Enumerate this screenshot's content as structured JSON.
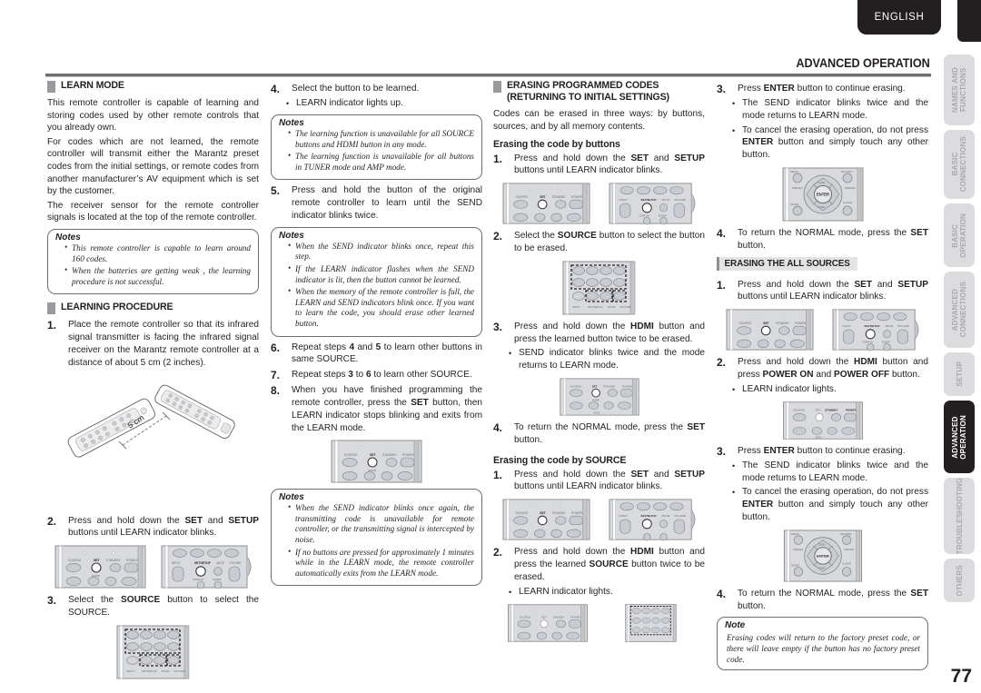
{
  "header": {
    "language_badge": "ENGLISH",
    "chapter_title": "ADVANCED OPERATION",
    "page_number": "77"
  },
  "sidebar": {
    "tabs": [
      {
        "label": "NAMES AND\nFUNCTIONS",
        "active": false
      },
      {
        "label": "BASIC\nCONNECTIONS",
        "active": false
      },
      {
        "label": "BASIC\nOPERATION",
        "active": false
      },
      {
        "label": "ADVANCED\nCONNECTIONS",
        "active": false
      },
      {
        "label": "SETUP",
        "active": false
      },
      {
        "label": "ADVANCED\nOPERATION",
        "active": true
      },
      {
        "label": "TROUBLESHOOTING",
        "active": false
      },
      {
        "label": "OTHERS",
        "active": false
      }
    ]
  },
  "col1": {
    "learn_mode_heading": "LEARN MODE",
    "p1": "This remote controller is capable of learning and storing codes used by other remote controls that you already own.",
    "p2": "For codes which are not learned, the remote controller will transmit either the Marantz preset codes from the initial settings, or remote codes from another manufacturer’s AV equipment which is set by the customer.",
    "p3": "The receiver sensor for the remote controller signals is located at the top of the remote controller.",
    "notes_label": "Notes",
    "note1": "This remote controller is capable to learn around 160 codes.",
    "note2": "When the batteries are getting weak , the learning procedure is not successful.",
    "procedure_heading": "LEARNING PROCEDURE",
    "step1_num": "1.",
    "step1_text": "Place the remote controller so that its infrared signal transmitter is facing the infrared signal receiver on the Marantz remote controller at a distance of about 5 cm (2 inches).",
    "fig_distance_label": "5 cm",
    "step2_num": "2.",
    "step2_a": "Press and hold down the ",
    "step2_set": "SET",
    "step2_b": " and ",
    "step2_setup": "SETUP",
    "step2_c": " buttons until LEARN indicator blinks.",
    "step3_num": "3.",
    "step3_a": "Select the ",
    "step3_source": "SOURCE",
    "step3_b": " button to select the SOURCE."
  },
  "col2": {
    "step4_num": "4.",
    "step4_text": "Select the button to be learned.",
    "step4_bullet": "LEARN indicator lights up.",
    "notes1_label": "Notes",
    "notes1_item1": "The learning function is unavailable for all SOURCE buttons and HDMI button in any mode.",
    "notes1_item2": "The learning function is unavailable for all buttons in TUNER mode and AMP mode.",
    "step5_num": "5.",
    "step5_text": "Press and hold the button of the original remote controller to learn until the SEND indicator blinks twice.",
    "notes2_label": "Notes",
    "notes2_item1": "When the SEND indicator blinks once, repeat this step.",
    "notes2_item2": "If the LEARN indicator flashes when the SEND indicator is lit, then the button cannot be learned.",
    "notes2_item3": "When the memory of the remote controller is full, the LEARN and SEND indicators blink once. If you want to learn the code, you should erase other learned button.",
    "step6_num": "6.",
    "step6_a": "Repeat steps ",
    "step6_4": "4",
    "step6_b": " and ",
    "step6_5": "5",
    "step6_c": " to learn other buttons in same SOURCE.",
    "step7_num": "7.",
    "step7_a": "Repeat steps ",
    "step7_3": "3",
    "step7_b": " to ",
    "step7_6": "6",
    "step7_c": " to learn other SOURCE.",
    "step8_num": "8.",
    "step8_a": "When you have finished programming the remote controller, press the ",
    "step8_set": "SET",
    "step8_b": " button, then LEARN indicator stops blinking and exits from the LEARN mode.",
    "notes3_label": "Notes",
    "notes3_item1": "When the SEND indicator blinks once again, the transmitting code is unavailable for remote controller, or the transmitting signal is intercepted by noise.",
    "notes3_item2": "If no buttons are pressed for approximately 1 minutes while in the LEARN mode, the remote controller automatically exits from the LEARN mode."
  },
  "col3": {
    "heading": "ERASING PROGRAMMED CODES\n(RETURNING TO INITIAL SETTINGS)",
    "intro": "Codes can be erased in three ways: by buttons, sources, and by all memory contents.",
    "sub1": "Erasing the code by buttons",
    "s1_num": "1.",
    "s1_a": "Press and hold down the ",
    "s1_set": "SET",
    "s1_b": " and ",
    "s1_setup": "SETUP",
    "s1_c": " buttons until LEARN indicator blinks.",
    "s2_num": "2.",
    "s2_a": "Select the ",
    "s2_source": "SOURCE",
    "s2_b": " button to select the button to be erased.",
    "s3_num": "3.",
    "s3_a": "Press and hold down the ",
    "s3_hdmi": "HDMI",
    "s3_b": " button and press the learned button twice to be erased.",
    "s3_bullet": "SEND indicator blinks twice and the mode returns to LEARN mode.",
    "s4_num": "4.",
    "s4_a": "To return the NORMAL mode, press the ",
    "s4_set": "SET",
    "s4_b": " button.",
    "sub2": "Erasing the code by SOURCE",
    "t1_num": "1.",
    "t1_a": "Press and hold down the ",
    "t1_set": "SET",
    "t1_b": " and ",
    "t1_setup": "SETUP",
    "t1_c": " buttons until LEARN indicator blinks.",
    "t2_num": "2.",
    "t2_a": "Press and hold down the ",
    "t2_hdmi": "HDMI",
    "t2_b": " button and press the learned ",
    "t2_source": "SOURCE",
    "t2_c": " button twice to be erased.",
    "t2_bullet": "LEARN indicator lights."
  },
  "col4": {
    "u3_num": "3.",
    "u3_a": "Press ",
    "u3_enter": "ENTER",
    "u3_b": " button to continue erasing.",
    "u3_bullet1": "The SEND indicator blinks twice and the mode returns to LEARN mode.",
    "u3_bullet2_a": "To cancel the erasing operation, do not press ",
    "u3_bullet2_enter": "ENTER",
    "u3_bullet2_b": " button and simply touch any other button.",
    "u4_num": "4.",
    "u4_a": "To return the NORMAL mode, press the ",
    "u4_set": "SET",
    "u4_b": " button.",
    "all_sources_heading": "ERASING THE ALL SOURCES",
    "v1_num": "1.",
    "v1_a": "Press and hold down the ",
    "v1_set": "SET",
    "v1_b": " and ",
    "v1_setup": "SETUP",
    "v1_c": " buttons until LEARN indicator blinks.",
    "v2_num": "2.",
    "v2_a": "Press and hold down the ",
    "v2_hdmi": "HDMI",
    "v2_b": " button and press ",
    "v2_poweron": "POWER ON",
    "v2_c": " and ",
    "v2_poweroff": "POWER OFF",
    "v2_d": " button.",
    "v2_bullet": "LEARN indicator lights.",
    "v3_num": "3.",
    "v3_a": "Press ",
    "v3_enter": "ENTER",
    "v3_b": " button to continue erasing.",
    "v3_bullet1": "The SEND indicator blinks twice and the mode returns to LEARN mode.",
    "v3_bullet2_a": "To cancel the erasing operation, do not press ",
    "v3_bullet2_enter": "ENTER",
    "v3_bullet2_b": " button and simply touch any other button.",
    "v4_num": "4.",
    "v4_a": "To return the NORMAL mode, press the ",
    "v4_set": "SET",
    "v4_b": " button.",
    "note_label": "Note",
    "note_text": "Erasing codes will return to the factory preset code, or there will leave empty if the button has no factory preset code."
  },
  "figures": {
    "remote_top_labels": [
      "SOURCE",
      "SET",
      "STANDBY",
      "POWER"
    ],
    "enter_label": "ENTER",
    "standby_label": "STANDBY",
    "volume_label": "VOLUME"
  },
  "colors": {
    "accent_dark": "#231f20",
    "rule": "#6d6e71",
    "tab_inactive_bg": "#dcdcde",
    "tab_inactive_fg": "#a7a9ac",
    "device_body": "#d9dade",
    "device_button": "#c9cbd2"
  }
}
